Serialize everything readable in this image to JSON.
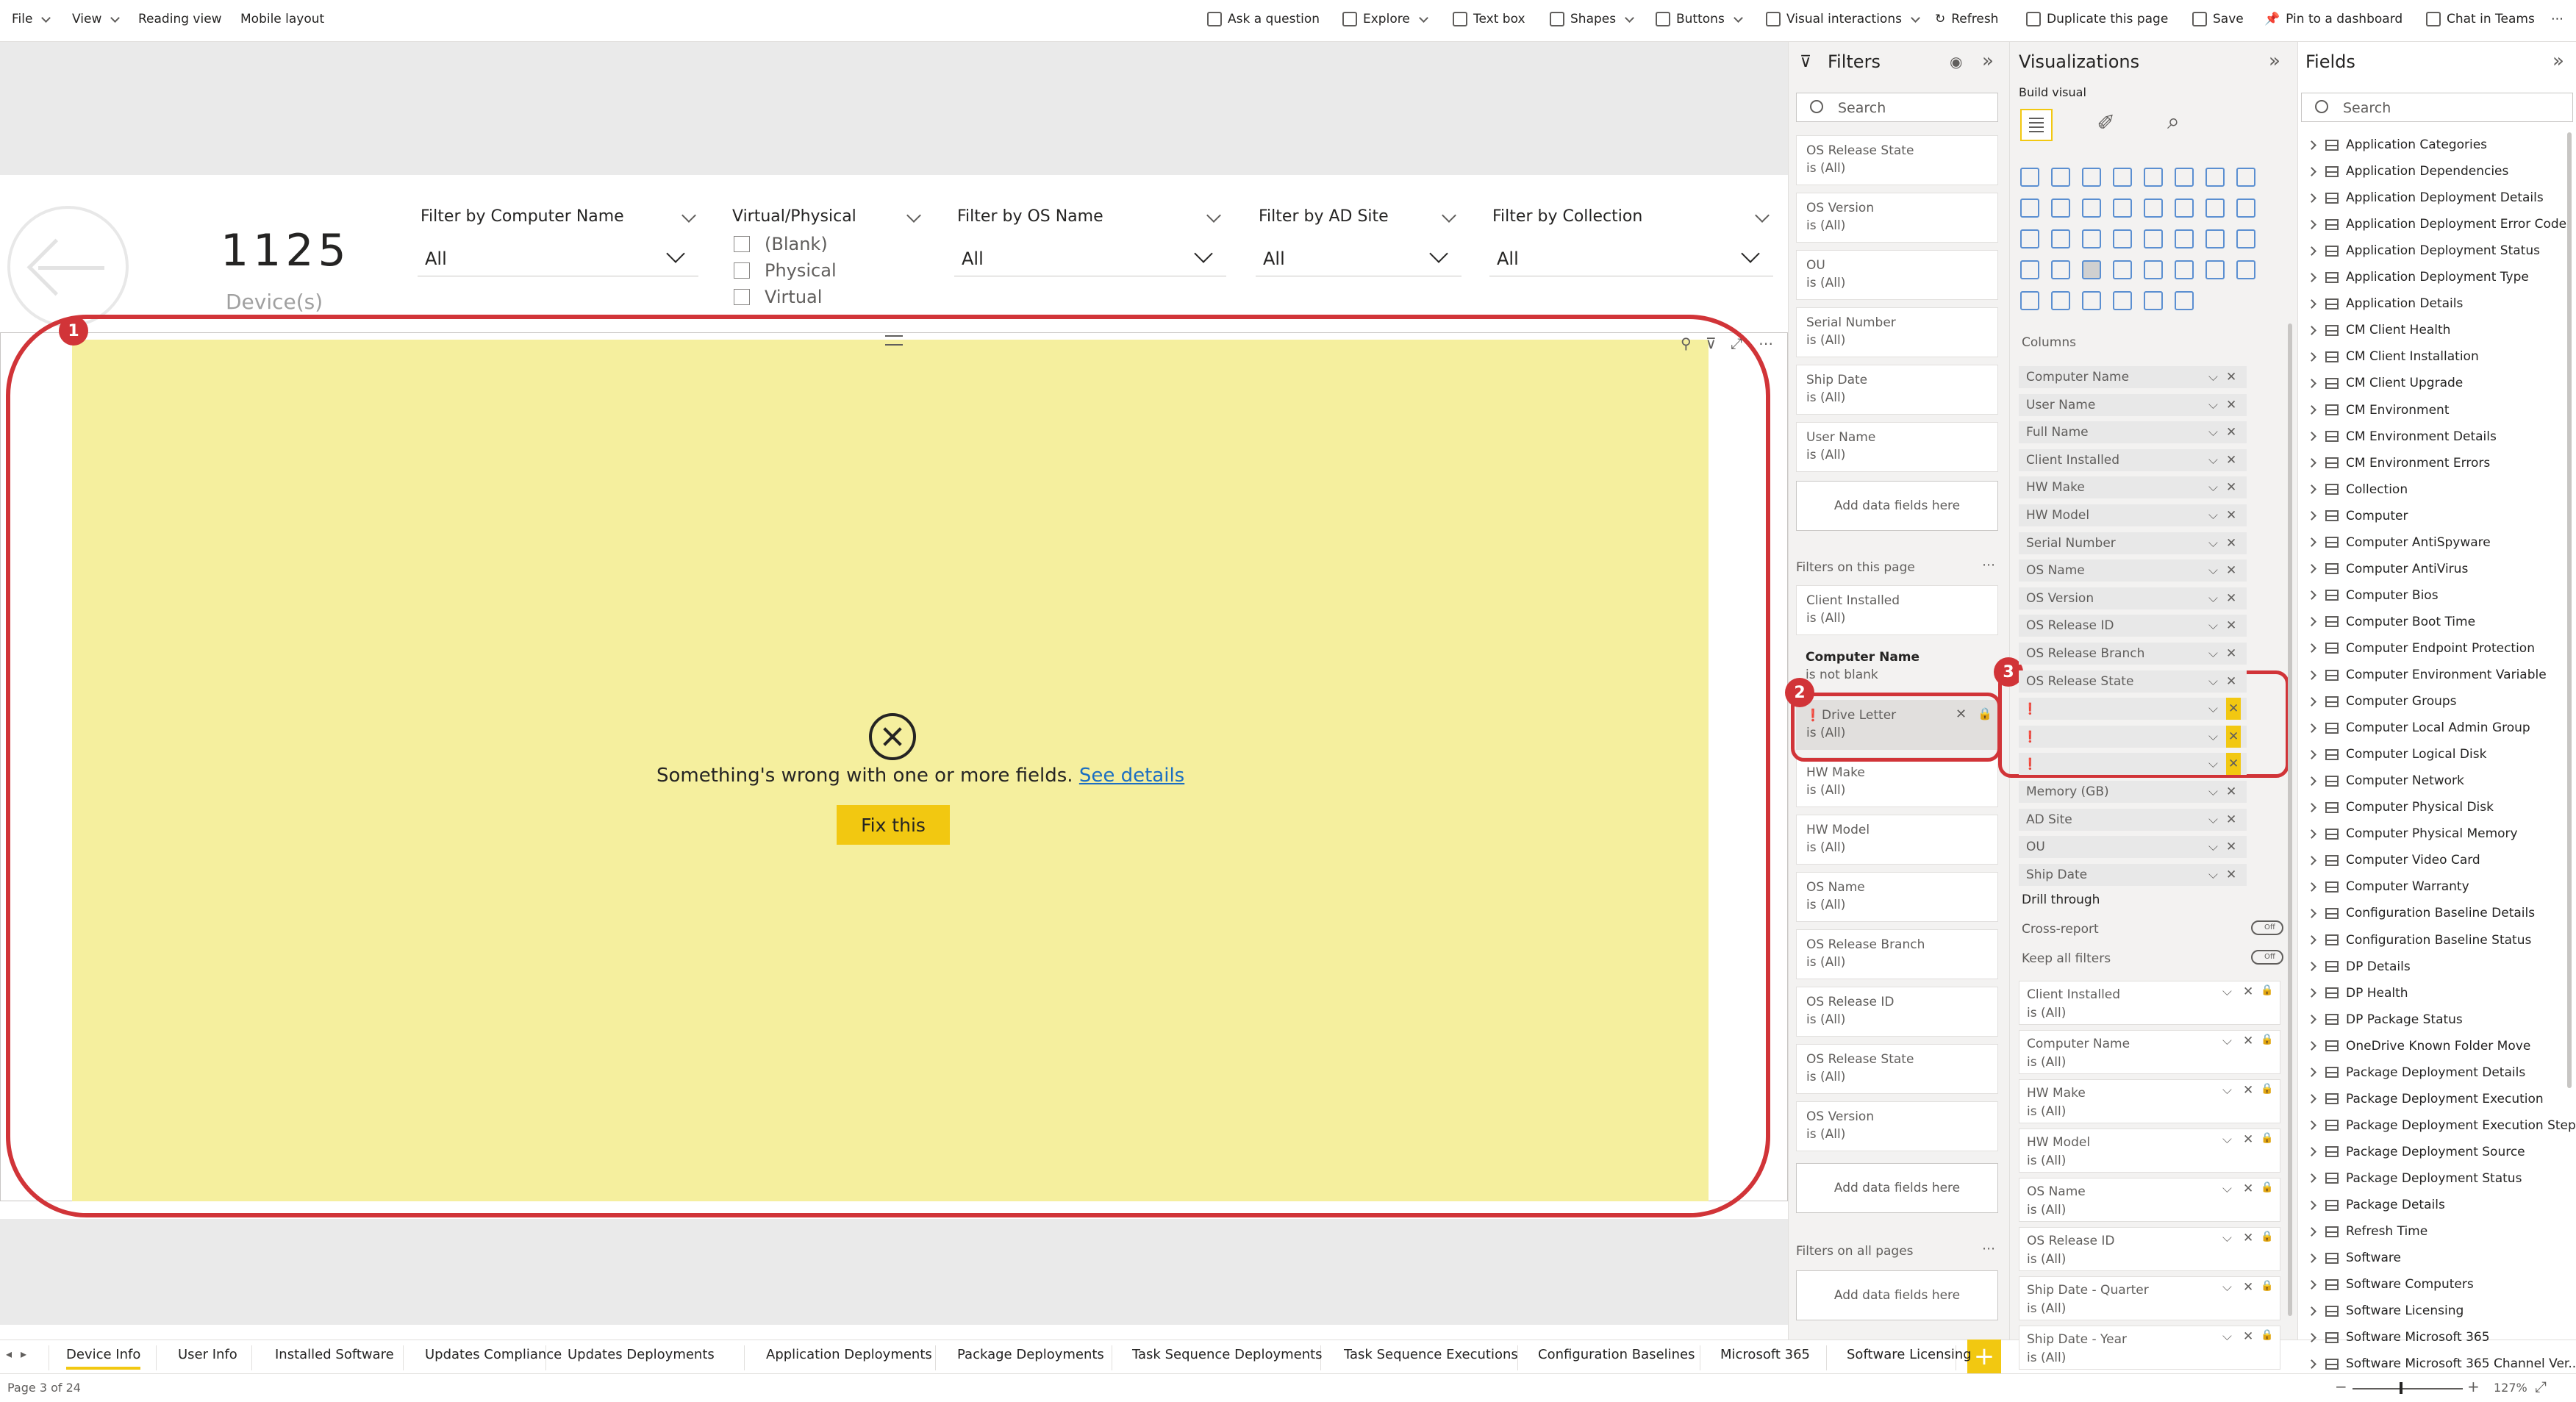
{
  "menu": {
    "file": "File",
    "view": "View",
    "reading_view": "Reading view",
    "mobile_layout": "Mobile layout",
    "ask_question": "Ask a question",
    "explore": "Explore",
    "text_box": "Text box",
    "shapes": "Shapes",
    "buttons": "Buttons",
    "visual_interactions": "Visual interactions",
    "refresh": "Refresh",
    "duplicate_page": "Duplicate this page",
    "save": "Save",
    "pin_dashboard": "Pin to a dashboard",
    "chat_teams": "Chat in Teams"
  },
  "header": {
    "device_count": "1125",
    "device_label": "Device(s)",
    "slicers": [
      {
        "title": "Filter by Computer Name",
        "value": "All"
      },
      {
        "title": "Virtual/Physical",
        "options": [
          "(Blank)",
          "Physical",
          "Virtual"
        ]
      },
      {
        "title": "Filter by OS Name",
        "value": "All"
      },
      {
        "title": "Filter by AD Site",
        "value": "All"
      },
      {
        "title": "Filter by Collection",
        "value": "All"
      }
    ]
  },
  "visual": {
    "error_text": "Something's wrong with one or more fields.",
    "see_details": "See details",
    "fix_button": "Fix this"
  },
  "callouts": [
    "1",
    "2",
    "3"
  ],
  "filters": {
    "title": "Filters",
    "search_placeholder": "Search",
    "visual_cards": [
      {
        "name": "OS Release State",
        "value": "is (All)"
      },
      {
        "name": "OS Version",
        "value": "is (All)"
      },
      {
        "name": "OU",
        "value": "is (All)"
      },
      {
        "name": "Serial Number",
        "value": "is (All)"
      },
      {
        "name": "Ship Date",
        "value": "is (All)"
      },
      {
        "name": "User Name",
        "value": "is (All)"
      }
    ],
    "add_fields": "Add data fields here",
    "page_section": "Filters on this page",
    "page_cards": [
      {
        "name": "Client Installed",
        "value": "is (All)"
      },
      {
        "name": "Computer Name",
        "value": "is not blank"
      },
      {
        "name": "Drive Letter",
        "value": "is (All)"
      },
      {
        "name": "HW Make",
        "value": "is (All)"
      },
      {
        "name": "HW Model",
        "value": "is (All)"
      },
      {
        "name": "OS Name",
        "value": "is (All)"
      },
      {
        "name": "OS Release Branch",
        "value": "is (All)"
      },
      {
        "name": "OS Release ID",
        "value": "is (All)"
      },
      {
        "name": "OS Release State",
        "value": "is (All)"
      },
      {
        "name": "OS Version",
        "value": "is (All)"
      }
    ],
    "all_pages_section": "Filters on all pages"
  },
  "visualizations": {
    "title": "Visualizations",
    "build_visual": "Build visual",
    "columns_label": "Columns",
    "columns": [
      "Computer Name",
      "User Name",
      "Full Name",
      "Client Installed",
      "HW Make",
      "HW Model",
      "Serial Number",
      "OS Name",
      "OS Version",
      "OS Release ID",
      "OS Release Branch",
      "OS Release State",
      "",
      "",
      "",
      "Memory (GB)",
      "AD Site",
      "OU",
      "Ship Date"
    ],
    "drill_through": "Drill through",
    "cross_report": "Cross-report",
    "keep_all_filters": "Keep all filters",
    "toggle_off": "Off",
    "drill_cards": [
      {
        "name": "Client Installed",
        "value": "is (All)"
      },
      {
        "name": "Computer Name",
        "value": "is (All)"
      },
      {
        "name": "HW Make",
        "value": "is (All)"
      },
      {
        "name": "HW Model",
        "value": "is (All)"
      },
      {
        "name": "OS Name",
        "value": "is (All)"
      },
      {
        "name": "OS Release ID",
        "value": "is (All)"
      },
      {
        "name": "Ship Date - Quarter",
        "value": "is (All)"
      },
      {
        "name": "Ship Date - Year",
        "value": "is (All)"
      }
    ]
  },
  "fields": {
    "title": "Fields",
    "search_placeholder": "Search",
    "tables": [
      "Application Categories",
      "Application Dependencies",
      "Application Deployment Details",
      "Application Deployment Error Code",
      "Application Deployment Status",
      "Application Deployment Type",
      "Application Details",
      "CM Client Health",
      "CM Client Installation",
      "CM Client Upgrade",
      "CM Environment",
      "CM Environment Details",
      "CM Environment Errors",
      "Collection",
      "Computer",
      "Computer AntiSpyware",
      "Computer AntiVirus",
      "Computer Bios",
      "Computer Boot Time",
      "Computer Endpoint Protection",
      "Computer Environment Variable",
      "Computer Groups",
      "Computer Local Admin Group",
      "Computer Logical Disk",
      "Computer Network",
      "Computer Physical Disk",
      "Computer Physical Memory",
      "Computer Video Card",
      "Computer Warranty",
      "Configuration Baseline Details",
      "Configuration Baseline Status",
      "DP Details",
      "DP Health",
      "DP Package Status",
      "OneDrive Known Folder Move",
      "Package Deployment Details",
      "Package Deployment Execution",
      "Package Deployment Execution Steps",
      "Package Deployment Source",
      "Package Deployment Status",
      "Package Details",
      "Refresh Time",
      "Software",
      "Software Computers",
      "Software Licensing",
      "Software Microsoft 365",
      "Software Microsoft 365 Channel Ver..."
    ]
  },
  "tabs": [
    "Device Info",
    "User Info",
    "Installed Software",
    "Updates Compliance",
    "Updates Deployments",
    "Application Deployments",
    "Package Deployments",
    "Task Sequence Deployments",
    "Task Sequence Executions",
    "Configuration Baselines",
    "Microsoft 365",
    "Software Licensing"
  ],
  "status": {
    "page_info": "Page 3 of 24",
    "zoom": "127%"
  },
  "colors": {
    "accent": "#f2c811",
    "highlight": "#d13438",
    "error_fill": "#f5ef9e",
    "link": "#1b6ec2"
  }
}
